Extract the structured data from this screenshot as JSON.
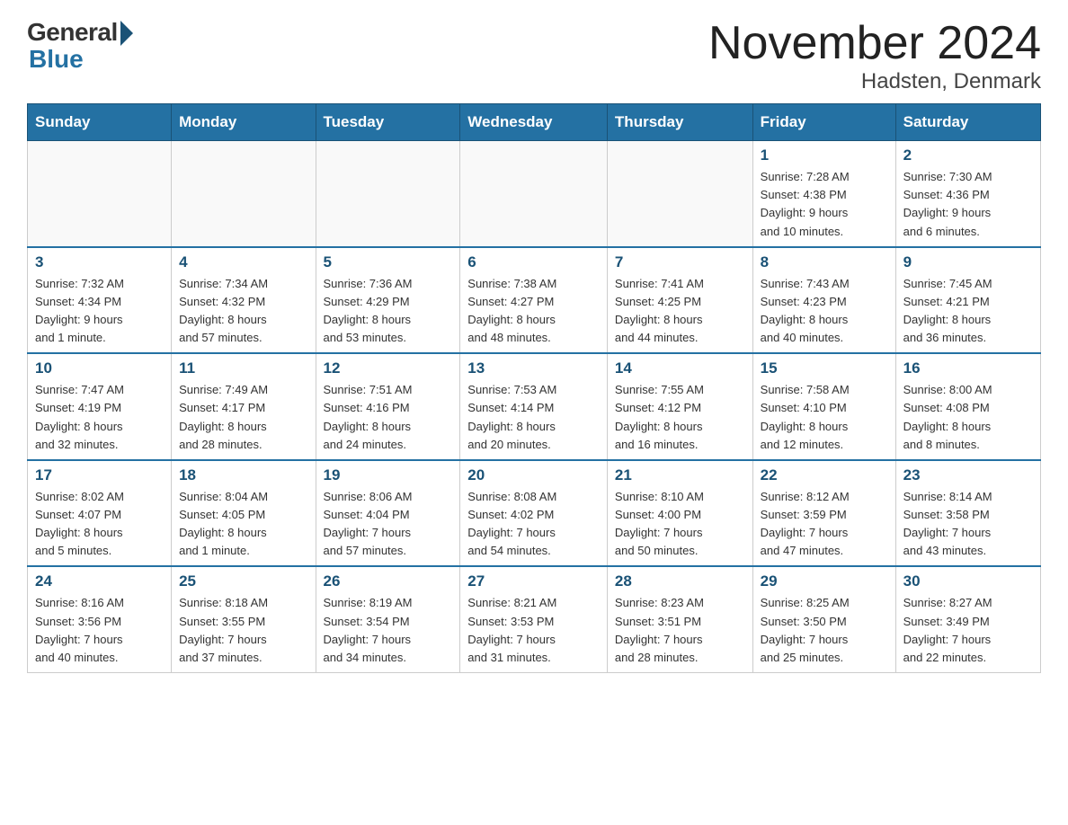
{
  "header": {
    "logo_general": "General",
    "logo_blue": "Blue",
    "title": "November 2024",
    "subtitle": "Hadsten, Denmark"
  },
  "days_of_week": [
    "Sunday",
    "Monday",
    "Tuesday",
    "Wednesday",
    "Thursday",
    "Friday",
    "Saturday"
  ],
  "weeks": [
    [
      {
        "day": "",
        "info": ""
      },
      {
        "day": "",
        "info": ""
      },
      {
        "day": "",
        "info": ""
      },
      {
        "day": "",
        "info": ""
      },
      {
        "day": "",
        "info": ""
      },
      {
        "day": "1",
        "info": "Sunrise: 7:28 AM\nSunset: 4:38 PM\nDaylight: 9 hours\nand 10 minutes."
      },
      {
        "day": "2",
        "info": "Sunrise: 7:30 AM\nSunset: 4:36 PM\nDaylight: 9 hours\nand 6 minutes."
      }
    ],
    [
      {
        "day": "3",
        "info": "Sunrise: 7:32 AM\nSunset: 4:34 PM\nDaylight: 9 hours\nand 1 minute."
      },
      {
        "day": "4",
        "info": "Sunrise: 7:34 AM\nSunset: 4:32 PM\nDaylight: 8 hours\nand 57 minutes."
      },
      {
        "day": "5",
        "info": "Sunrise: 7:36 AM\nSunset: 4:29 PM\nDaylight: 8 hours\nand 53 minutes."
      },
      {
        "day": "6",
        "info": "Sunrise: 7:38 AM\nSunset: 4:27 PM\nDaylight: 8 hours\nand 48 minutes."
      },
      {
        "day": "7",
        "info": "Sunrise: 7:41 AM\nSunset: 4:25 PM\nDaylight: 8 hours\nand 44 minutes."
      },
      {
        "day": "8",
        "info": "Sunrise: 7:43 AM\nSunset: 4:23 PM\nDaylight: 8 hours\nand 40 minutes."
      },
      {
        "day": "9",
        "info": "Sunrise: 7:45 AM\nSunset: 4:21 PM\nDaylight: 8 hours\nand 36 minutes."
      }
    ],
    [
      {
        "day": "10",
        "info": "Sunrise: 7:47 AM\nSunset: 4:19 PM\nDaylight: 8 hours\nand 32 minutes."
      },
      {
        "day": "11",
        "info": "Sunrise: 7:49 AM\nSunset: 4:17 PM\nDaylight: 8 hours\nand 28 minutes."
      },
      {
        "day": "12",
        "info": "Sunrise: 7:51 AM\nSunset: 4:16 PM\nDaylight: 8 hours\nand 24 minutes."
      },
      {
        "day": "13",
        "info": "Sunrise: 7:53 AM\nSunset: 4:14 PM\nDaylight: 8 hours\nand 20 minutes."
      },
      {
        "day": "14",
        "info": "Sunrise: 7:55 AM\nSunset: 4:12 PM\nDaylight: 8 hours\nand 16 minutes."
      },
      {
        "day": "15",
        "info": "Sunrise: 7:58 AM\nSunset: 4:10 PM\nDaylight: 8 hours\nand 12 minutes."
      },
      {
        "day": "16",
        "info": "Sunrise: 8:00 AM\nSunset: 4:08 PM\nDaylight: 8 hours\nand 8 minutes."
      }
    ],
    [
      {
        "day": "17",
        "info": "Sunrise: 8:02 AM\nSunset: 4:07 PM\nDaylight: 8 hours\nand 5 minutes."
      },
      {
        "day": "18",
        "info": "Sunrise: 8:04 AM\nSunset: 4:05 PM\nDaylight: 8 hours\nand 1 minute."
      },
      {
        "day": "19",
        "info": "Sunrise: 8:06 AM\nSunset: 4:04 PM\nDaylight: 7 hours\nand 57 minutes."
      },
      {
        "day": "20",
        "info": "Sunrise: 8:08 AM\nSunset: 4:02 PM\nDaylight: 7 hours\nand 54 minutes."
      },
      {
        "day": "21",
        "info": "Sunrise: 8:10 AM\nSunset: 4:00 PM\nDaylight: 7 hours\nand 50 minutes."
      },
      {
        "day": "22",
        "info": "Sunrise: 8:12 AM\nSunset: 3:59 PM\nDaylight: 7 hours\nand 47 minutes."
      },
      {
        "day": "23",
        "info": "Sunrise: 8:14 AM\nSunset: 3:58 PM\nDaylight: 7 hours\nand 43 minutes."
      }
    ],
    [
      {
        "day": "24",
        "info": "Sunrise: 8:16 AM\nSunset: 3:56 PM\nDaylight: 7 hours\nand 40 minutes."
      },
      {
        "day": "25",
        "info": "Sunrise: 8:18 AM\nSunset: 3:55 PM\nDaylight: 7 hours\nand 37 minutes."
      },
      {
        "day": "26",
        "info": "Sunrise: 8:19 AM\nSunset: 3:54 PM\nDaylight: 7 hours\nand 34 minutes."
      },
      {
        "day": "27",
        "info": "Sunrise: 8:21 AM\nSunset: 3:53 PM\nDaylight: 7 hours\nand 31 minutes."
      },
      {
        "day": "28",
        "info": "Sunrise: 8:23 AM\nSunset: 3:51 PM\nDaylight: 7 hours\nand 28 minutes."
      },
      {
        "day": "29",
        "info": "Sunrise: 8:25 AM\nSunset: 3:50 PM\nDaylight: 7 hours\nand 25 minutes."
      },
      {
        "day": "30",
        "info": "Sunrise: 8:27 AM\nSunset: 3:49 PM\nDaylight: 7 hours\nand 22 minutes."
      }
    ]
  ]
}
